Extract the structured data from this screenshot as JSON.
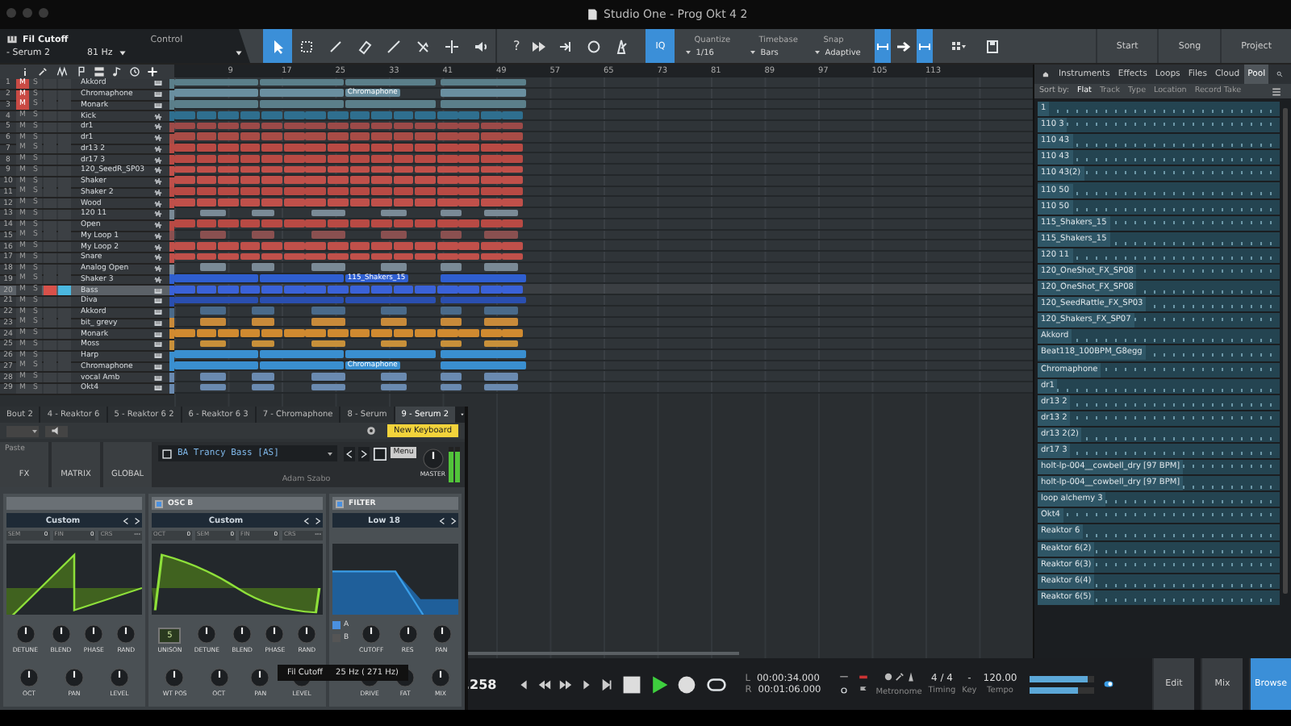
{
  "window": {
    "title": "Studio One - Prog Okt 4 2"
  },
  "toolbar": {
    "parameter": "Fil Cutoff",
    "instrument": "- Serum 2",
    "value": "81 Hz",
    "mode": "Control",
    "tools": [
      {
        "kind": "arrow",
        "selected": true
      },
      {
        "kind": "range",
        "selected": false
      },
      {
        "kind": "pencil",
        "selected": false
      },
      {
        "kind": "eraser",
        "selected": false
      },
      {
        "kind": "line",
        "selected": false
      },
      {
        "kind": "mute",
        "selected": false
      },
      {
        "kind": "split",
        "selected": false
      },
      {
        "kind": "listen",
        "selected": false
      }
    ],
    "help": "?",
    "iq": "IQ",
    "fields": [
      {
        "label": "Quantize",
        "value": "1/16"
      },
      {
        "label": "Timebase",
        "value": "Bars"
      },
      {
        "label": "Snap",
        "value": "Adaptive"
      }
    ],
    "right_buttons": [
      "Start",
      "Song",
      "Project"
    ]
  },
  "ruler": [
    "9",
    "17",
    "25",
    "33",
    "41",
    "49",
    "57",
    "65",
    "73",
    "81",
    "89",
    "97",
    "105",
    "113"
  ],
  "tracks": [
    {
      "number": "1",
      "mute": "M",
      "solo": "S",
      "name": "Akkord",
      "kind": "instrument",
      "muted": true,
      "armed": false,
      "monitor": false,
      "selected": false,
      "color": "#5b7f8a",
      "lane": {
        "kind": "blocks"
      }
    },
    {
      "number": "2",
      "mute": "M",
      "solo": "S",
      "name": "Chromaphone",
      "kind": "instrument",
      "muted": true,
      "armed": false,
      "monitor": false,
      "selected": false,
      "color": "#6a8fa0",
      "lane": {
        "kind": "blocks"
      },
      "clip_label": "Chromaphone"
    },
    {
      "number": "3",
      "mute": "M",
      "solo": "S",
      "name": "Monark",
      "kind": "instrument",
      "muted": true,
      "armed": false,
      "monitor": false,
      "selected": false,
      "color": "#5b7f8a",
      "lane": {
        "kind": "blocks"
      }
    },
    {
      "number": "4",
      "mute": "M",
      "solo": "S",
      "name": "Kick",
      "kind": "audio",
      "muted": false,
      "armed": false,
      "monitor": false,
      "selected": false,
      "color": "#2f6f8f",
      "lane": {
        "kind": "dense"
      }
    },
    {
      "number": "5",
      "mute": "M",
      "solo": "S",
      "name": "dr1",
      "kind": "audio",
      "muted": false,
      "armed": false,
      "monitor": false,
      "selected": false,
      "color": "#9c4a48",
      "lane": {
        "kind": "dense"
      }
    },
    {
      "number": "6",
      "mute": "M",
      "solo": "S",
      "name": "dr1",
      "kind": "audio",
      "muted": false,
      "armed": false,
      "monitor": false,
      "selected": false,
      "color": "#a84c46",
      "lane": {
        "kind": "dense"
      }
    },
    {
      "number": "7",
      "mute": "M",
      "solo": "S",
      "name": "dr13 2",
      "kind": "audio",
      "muted": false,
      "armed": false,
      "monitor": false,
      "selected": false,
      "color": "#b84a44",
      "lane": {
        "kind": "dense"
      }
    },
    {
      "number": "8",
      "mute": "M",
      "solo": "S",
      "name": "dr17 3",
      "kind": "audio",
      "muted": false,
      "armed": false,
      "monitor": false,
      "selected": false,
      "color": "#b84a44",
      "lane": {
        "kind": "dense"
      }
    },
    {
      "number": "9",
      "mute": "M",
      "solo": "S",
      "name": "120_SeedR_SP03",
      "kind": "audio",
      "muted": false,
      "armed": false,
      "monitor": false,
      "selected": false,
      "color": "#c0504a",
      "lane": {
        "kind": "dense"
      }
    },
    {
      "number": "10",
      "mute": "M",
      "solo": "S",
      "name": "Shaker",
      "kind": "audio",
      "muted": false,
      "armed": false,
      "monitor": false,
      "selected": false,
      "color": "#c0504a",
      "lane": {
        "kind": "dense"
      }
    },
    {
      "number": "11",
      "mute": "M",
      "solo": "S",
      "name": "Shaker 2",
      "kind": "audio",
      "muted": false,
      "armed": false,
      "monitor": false,
      "selected": false,
      "color": "#b84a44",
      "lane": {
        "kind": "dense"
      }
    },
    {
      "number": "12",
      "mute": "M",
      "solo": "S",
      "name": "Wood",
      "kind": "audio",
      "muted": false,
      "armed": false,
      "monitor": false,
      "selected": false,
      "color": "#c0504a",
      "lane": {
        "kind": "dense"
      }
    },
    {
      "number": "13",
      "mute": "M",
      "solo": "S",
      "name": "120 11",
      "kind": "audio",
      "muted": false,
      "armed": false,
      "monitor": false,
      "selected": false,
      "color": "#7a8a96",
      "lane": {
        "kind": "sparse"
      }
    },
    {
      "number": "14",
      "mute": "M",
      "solo": "S",
      "name": "Open",
      "kind": "audio",
      "muted": false,
      "armed": false,
      "monitor": false,
      "selected": false,
      "color": "#b84a44",
      "lane": {
        "kind": "dense"
      }
    },
    {
      "number": "15",
      "mute": "M",
      "solo": "S",
      "name": "My Loop 1",
      "kind": "audio",
      "muted": false,
      "armed": false,
      "monitor": false,
      "selected": false,
      "color": "#8a5050",
      "lane": {
        "kind": "sparse"
      }
    },
    {
      "number": "16",
      "mute": "M",
      "solo": "S",
      "name": "My Loop 2",
      "kind": "audio",
      "muted": false,
      "armed": false,
      "monitor": false,
      "selected": false,
      "color": "#c0504a",
      "lane": {
        "kind": "dense"
      }
    },
    {
      "number": "17",
      "mute": "M",
      "solo": "S",
      "name": "Snare",
      "kind": "audio",
      "muted": false,
      "armed": false,
      "monitor": false,
      "selected": false,
      "color": "#c0504a",
      "lane": {
        "kind": "dense"
      }
    },
    {
      "number": "18",
      "mute": "M",
      "solo": "S",
      "name": "Analog Open",
      "kind": "audio",
      "muted": false,
      "armed": false,
      "monitor": false,
      "selected": false,
      "color": "#7a8a96",
      "lane": {
        "kind": "sparse"
      }
    },
    {
      "number": "19",
      "mute": "M",
      "solo": "S",
      "name": "Shaker 3",
      "kind": "audio",
      "muted": false,
      "armed": false,
      "monitor": false,
      "selected": false,
      "color": "#2f5fd0",
      "lane": {
        "kind": "blocks"
      },
      "clip_label": "115_Shakers_15"
    },
    {
      "number": "20",
      "mute": "M",
      "solo": "S",
      "name": "Bass",
      "kind": "instrument",
      "muted": false,
      "armed": true,
      "monitor": true,
      "selected": true,
      "color": "#3a62d8",
      "lane": {
        "kind": "dense"
      }
    },
    {
      "number": "21",
      "mute": "M",
      "solo": "S",
      "name": "Diva",
      "kind": "instrument",
      "muted": false,
      "armed": false,
      "monitor": false,
      "selected": false,
      "color": "#2a4fb0",
      "lane": {
        "kind": "blocks"
      }
    },
    {
      "number": "22",
      "mute": "M",
      "solo": "S",
      "name": "Akkord",
      "kind": "instrument",
      "muted": false,
      "armed": false,
      "monitor": false,
      "selected": false,
      "color": "#4a6a8a",
      "lane": {
        "kind": "sparse"
      }
    },
    {
      "number": "23",
      "mute": "M",
      "solo": "S",
      "name": "bit_ grevy",
      "kind": "instrument",
      "muted": false,
      "armed": false,
      "monitor": false,
      "selected": false,
      "color": "#c88a3a",
      "lane": {
        "kind": "sparse"
      }
    },
    {
      "number": "24",
      "mute": "M",
      "solo": "S",
      "name": "Monark",
      "kind": "instrument",
      "muted": false,
      "armed": false,
      "monitor": false,
      "selected": false,
      "color": "#d08a30",
      "lane": {
        "kind": "dense"
      }
    },
    {
      "number": "25",
      "mute": "M",
      "solo": "S",
      "name": "Moss",
      "kind": "instrument",
      "muted": false,
      "armed": false,
      "monitor": false,
      "selected": false,
      "color": "#c8903a",
      "lane": {
        "kind": "sparse"
      }
    },
    {
      "number": "26",
      "mute": "M",
      "solo": "S",
      "name": "Harp",
      "kind": "instrument",
      "muted": false,
      "armed": false,
      "monitor": false,
      "selected": false,
      "color": "#3a8fd0",
      "lane": {
        "kind": "blocks"
      }
    },
    {
      "number": "27",
      "mute": "M",
      "solo": "S",
      "name": "Chromaphone",
      "kind": "instrument",
      "muted": false,
      "armed": false,
      "monitor": false,
      "selected": false,
      "color": "#3a8fd0",
      "lane": {
        "kind": "blocks"
      },
      "clip_label": "Chromaphone"
    },
    {
      "number": "28",
      "mute": "M",
      "solo": "S",
      "name": "vocal Amb",
      "kind": "instrument",
      "muted": false,
      "armed": false,
      "monitor": false,
      "selected": false,
      "color": "#6a8ab0",
      "lane": {
        "kind": "sparse"
      }
    },
    {
      "number": "29",
      "mute": "M",
      "solo": "S",
      "name": "Okt4",
      "kind": "instrument",
      "muted": false,
      "armed": false,
      "monitor": false,
      "selected": false,
      "color": "#6a8ab0",
      "lane": {
        "kind": "sparse"
      }
    }
  ],
  "browser": {
    "tabs": [
      {
        "label": "Instruments",
        "selected": false
      },
      {
        "label": "Effects",
        "selected": false
      },
      {
        "label": "Loops",
        "selected": false
      },
      {
        "label": "Files",
        "selected": false
      },
      {
        "label": "Cloud",
        "selected": false
      },
      {
        "label": "Pool",
        "selected": true
      }
    ],
    "sort_label": "Sort by:",
    "sort_options": [
      {
        "label": "Flat",
        "selected": true
      },
      {
        "label": "Track",
        "selected": false
      },
      {
        "label": "Type",
        "selected": false
      },
      {
        "label": "Location",
        "selected": false
      },
      {
        "label": "Record Take",
        "selected": false
      }
    ],
    "items": [
      "1",
      "110 3",
      "110 43",
      "110 43",
      "110 43(2)",
      "110 50",
      "110 50",
      "115_Shakers_15",
      "115_Shakers_15",
      "120 11",
      "120_OneShot_FX_SP08",
      "120_OneShot_FX_SP08",
      "120_SeedRattle_FX_SP03",
      "120_Shakers_FX_SP07",
      "Akkord",
      "Beat118_100BPM_G8egg",
      "Chromaphone",
      "dr1",
      "dr13 2",
      "dr13 2",
      "dr13 2(2)",
      "dr17 3",
      "holt-lp-004__cowbell_dry [97 BPM]",
      "holt-lp-004__cowbell_dry [97 BPM]",
      "loop alchemy 3",
      "Okt4",
      "Reaktor 6",
      "Reaktor 6(2)",
      "Reaktor 6(3)",
      "Reaktor 6(4)",
      "Reaktor 6(5)"
    ]
  },
  "plugin": {
    "tabs": [
      {
        "label": "Bout 2",
        "selected": false
      },
      {
        "label": "4 - Reaktor 6",
        "selected": false
      },
      {
        "label": "5 - Reaktor 6 2",
        "selected": false
      },
      {
        "label": "6 - Reaktor 6 3",
        "selected": false
      },
      {
        "label": "7 - Chromaphone",
        "selected": false
      },
      {
        "label": "8 - Serum",
        "selected": false
      },
      {
        "label": "9 - Serum 2",
        "selected": true
      }
    ],
    "paste": "Paste",
    "keyboard": "New Keyboard",
    "serum_tabs": [
      "FX",
      "MATRIX",
      "GLOBAL"
    ],
    "preset": "BA Trancy Bass [AS]",
    "author": "Adam Szabo",
    "menu": "Menu",
    "master": "MASTER",
    "meters": [
      {
        "level": 0.85
      },
      {
        "level": 0.85
      }
    ],
    "sections": [
      {
        "kind": "osc",
        "wavetable": "Custom",
        "wave": {
          "kind": "saw"
        },
        "params": [
          {
            "label": "SEM",
            "value": "0"
          },
          {
            "label": "FIN",
            "value": "0"
          },
          {
            "label": "CRS",
            "value": "---"
          }
        ],
        "knobs": [
          [
            "DETUNE",
            "BLEND",
            "PHASE",
            "RAND"
          ],
          [
            "OCT",
            "PAN",
            "LEVEL"
          ]
        ]
      },
      {
        "kind": "osc",
        "title": "OSC B",
        "on": true,
        "wavetable": "Custom",
        "wave": {
          "kind": "curve"
        },
        "unison": "5",
        "unison_label": "UNISON",
        "params": [
          {
            "label": "OCT",
            "value": "0"
          },
          {
            "label": "SEM",
            "value": "0"
          },
          {
            "label": "FIN",
            "value": "0"
          },
          {
            "label": "CRS",
            "value": "---"
          }
        ],
        "knobs": [
          [
            "DETUNE",
            "BLEND",
            "PHASE",
            "RAND"
          ],
          [
            "WT POS",
            "OCT",
            "PAN",
            "LEVEL"
          ]
        ]
      },
      {
        "kind": "filter",
        "title": "FILTER",
        "on": true,
        "type": "Low 18",
        "routes": [
          {
            "label": "A",
            "checked": true
          },
          {
            "label": "B",
            "checked": false
          }
        ],
        "knobs": [
          [
            "CUTOFF",
            "RES",
            "PAN"
          ],
          [
            "DRIVE",
            "FAT",
            "MIX"
          ]
        ]
      }
    ],
    "tooltip": {
      "name": "Fil Cutoff",
      "value": "25 Hz ( 271 Hz)"
    }
  },
  "transport": {
    "position": ".258",
    "left_label": "L",
    "left_time": "00:00:34.000",
    "right_label": "R",
    "right_time": "00:01:06.000",
    "playing": true,
    "metronome": "Metronome",
    "timing": "4 / 4",
    "timing_label": "Timing",
    "key": "-",
    "key_label": "Key",
    "tempo": "120.00",
    "tempo_label": "Tempo",
    "meters": [
      {
        "level": 0.9
      },
      {
        "level": 0.75
      }
    ],
    "views": [
      {
        "label": "Edit",
        "selected": false
      },
      {
        "label": "Mix",
        "selected": false
      },
      {
        "label": "Browse",
        "selected": true
      }
    ]
  }
}
